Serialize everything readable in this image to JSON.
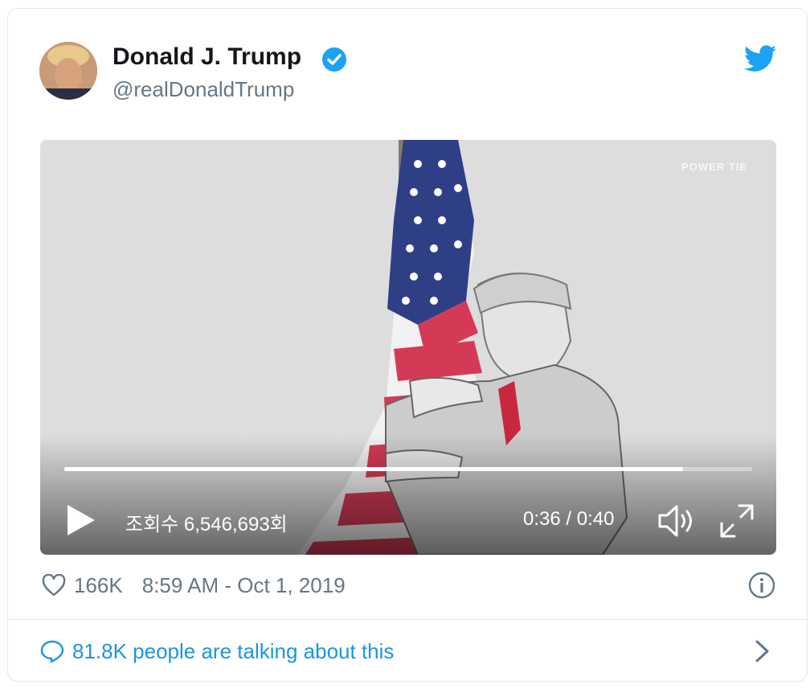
{
  "tweet": {
    "display_name": "Donald J. Trump",
    "handle": "@realDonaldTrump",
    "likes": "166K",
    "timestamp": "8:59 AM - Oct 1, 2019",
    "talking": "81.8K people are talking about this"
  },
  "video": {
    "watermark": "POWER TIE",
    "views": "조회수 6,546,693회",
    "time": "0:36 / 0:40",
    "progress": 0.9
  },
  "icons": {
    "verified": "verified-badge-icon",
    "brand": "twitter-bird-icon",
    "play": "play-icon",
    "volume": "volume-icon",
    "fullscreen": "fullscreen-icon",
    "like": "heart-icon",
    "info": "info-icon",
    "talk": "speech-bubble-icon",
    "chevron": "chevron-right-icon"
  },
  "colors": {
    "accent": "#1b95e0",
    "verified": "#1da1f2",
    "muted": "#657786",
    "text": "#14171a"
  }
}
